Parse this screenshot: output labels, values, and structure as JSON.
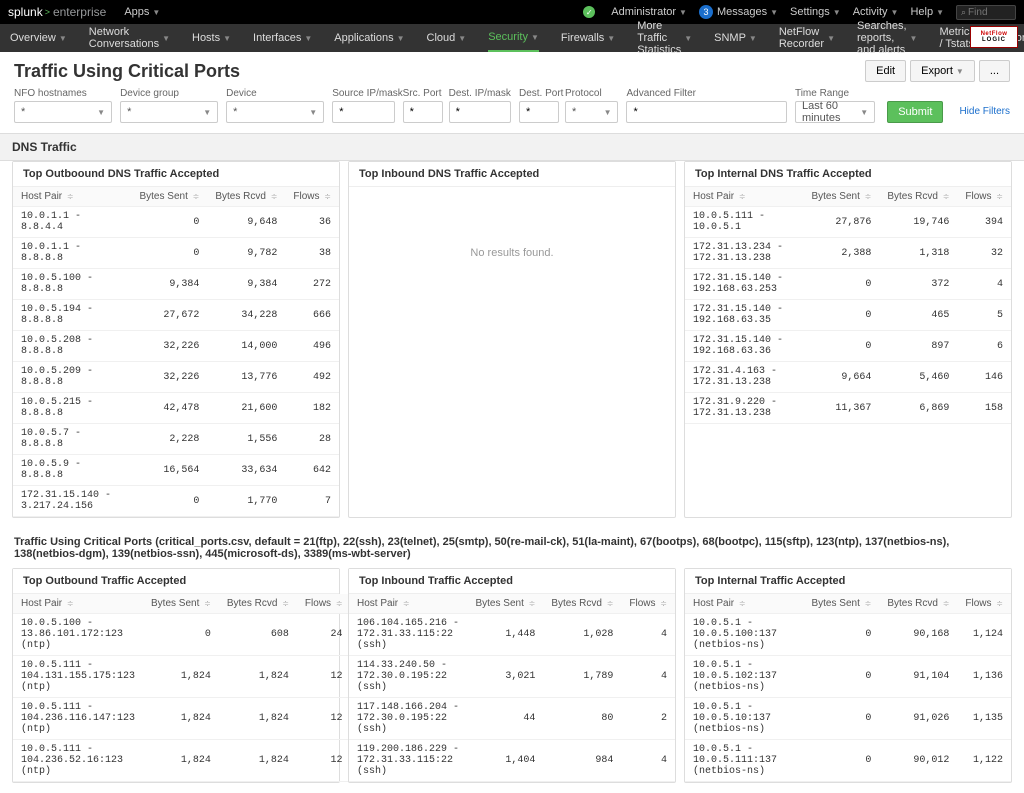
{
  "topbar": {
    "brand_main": "splunk",
    "brand_sub": "enterprise",
    "apps": "Apps",
    "admin": "Administrator",
    "messages_count": 3,
    "messages": "Messages",
    "settings": "Settings",
    "activity": "Activity",
    "help": "Help",
    "find_placeholder": "Find"
  },
  "nav": {
    "items": [
      "Overview",
      "Network Conversations",
      "Hosts",
      "Interfaces",
      "Applications",
      "Cloud",
      "Security",
      "Firewalls",
      "More Traffic Statistics",
      "SNMP",
      "NetFlow Recorder",
      "Searches, reports, and alerts",
      "Metrics / Tstats",
      "Configuration"
    ],
    "selected": 6,
    "logo1": "NetFlow",
    "logo2": "LOGIC"
  },
  "page": {
    "title": "Traffic Using Critical Ports",
    "edit": "Edit",
    "export": "Export",
    "more": "..."
  },
  "controls": {
    "labels": {
      "nfo": "NFO hostnames",
      "dgroup": "Device group",
      "device": "Device",
      "srcip": "Source IP/mask",
      "srcport": "Src. Port",
      "destip": "Dest. IP/mask",
      "destport": "Dest. Port",
      "proto": "Protocol",
      "adv": "Advanced Filter",
      "trange": "Time Range"
    },
    "values": {
      "nfo": "*",
      "dgroup": "*",
      "device": "*",
      "srcip": "*",
      "srcport": "*",
      "destip": "*",
      "destport": "*",
      "proto": "*",
      "adv": "*",
      "trange": "Last 60 minutes"
    },
    "submit": "Submit",
    "hide": "Hide Filters"
  },
  "dns_section": "DNS Traffic",
  "dns": {
    "out": {
      "title": "Top Outboound DNS Traffic Accepted",
      "cols": [
        "Host Pair",
        "Bytes Sent",
        "Bytes Rcvd",
        "Flows"
      ],
      "rows": [
        [
          "10.0.1.1 - 8.8.4.4",
          "0",
          "9,648",
          "36"
        ],
        [
          "10.0.1.1 - 8.8.8.8",
          "0",
          "9,782",
          "38"
        ],
        [
          "10.0.5.100 - 8.8.8.8",
          "9,384",
          "9,384",
          "272"
        ],
        [
          "10.0.5.194 - 8.8.8.8",
          "27,672",
          "34,228",
          "666"
        ],
        [
          "10.0.5.208 - 8.8.8.8",
          "32,226",
          "14,000",
          "496"
        ],
        [
          "10.0.5.209 - 8.8.8.8",
          "32,226",
          "13,776",
          "492"
        ],
        [
          "10.0.5.215 - 8.8.8.8",
          "42,478",
          "21,600",
          "182"
        ],
        [
          "10.0.5.7 - 8.8.8.8",
          "2,228",
          "1,556",
          "28"
        ],
        [
          "10.0.5.9 - 8.8.8.8",
          "16,564",
          "33,634",
          "642"
        ],
        [
          "172.31.15.140 - 3.217.24.156",
          "0",
          "1,770",
          "7"
        ]
      ]
    },
    "in": {
      "title": "Top Inbound DNS Traffic Accepted",
      "no_results": "No results found."
    },
    "internal": {
      "title": "Top Internal DNS Traffic Accepted",
      "cols": [
        "Host Pair",
        "Bytes Sent",
        "Bytes Rcvd",
        "Flows"
      ],
      "rows": [
        [
          "10.0.5.111 - 10.0.5.1",
          "27,876",
          "19,746",
          "394"
        ],
        [
          "172.31.13.234 - 172.31.13.238",
          "2,388",
          "1,318",
          "32"
        ],
        [
          "172.31.15.140 - 192.168.63.253",
          "0",
          "372",
          "4"
        ],
        [
          "172.31.15.140 - 192.168.63.35",
          "0",
          "465",
          "5"
        ],
        [
          "172.31.15.140 - 192.168.63.36",
          "0",
          "897",
          "6"
        ],
        [
          "172.31.4.163 - 172.31.13.238",
          "9,664",
          "5,460",
          "146"
        ],
        [
          "172.31.9.220 - 172.31.13.238",
          "11,367",
          "6,869",
          "158"
        ]
      ]
    }
  },
  "critical_desc": "Traffic Using Critical Ports (critical_ports.csv, default = 21(ftp), 22(ssh), 23(telnet), 25(smtp), 50(re-mail-ck), 51(la-maint), 67(bootps), 68(bootpc), 115(sftp), 123(ntp), 137(netbios-ns), 138(netbios-dgm), 139(netbios-ssn), 445(microsoft-ds), 3389(ms-wbt-server)",
  "crit": {
    "out": {
      "title": "Top Outbound Traffic Accepted",
      "cols": [
        "Host Pair",
        "Bytes Sent",
        "Bytes Rcvd",
        "Flows"
      ],
      "rows": [
        [
          "10.0.5.100 - 13.86.101.172:123 (ntp)",
          "0",
          "608",
          "24"
        ],
        [
          "10.0.5.111 - 104.131.155.175:123 (ntp)",
          "1,824",
          "1,824",
          "12"
        ],
        [
          "10.0.5.111 - 104.236.116.147:123 (ntp)",
          "1,824",
          "1,824",
          "12"
        ],
        [
          "10.0.5.111 - 104.236.52.16:123 (ntp)",
          "1,824",
          "1,824",
          "12"
        ]
      ]
    },
    "in": {
      "title": "Top Inbound Traffic Accepted",
      "cols": [
        "Host Pair",
        "Bytes Sent",
        "Bytes Rcvd",
        "Flows"
      ],
      "rows": [
        [
          "106.104.165.216 - 172.31.33.115:22 (ssh)",
          "1,448",
          "1,028",
          "4"
        ],
        [
          "114.33.240.50 - 172.30.0.195:22 (ssh)",
          "3,021",
          "1,789",
          "4"
        ],
        [
          "117.148.166.204 - 172.30.0.195:22 (ssh)",
          "44",
          "80",
          "2"
        ],
        [
          "119.200.186.229 - 172.31.33.115:22 (ssh)",
          "1,404",
          "984",
          "4"
        ]
      ]
    },
    "internal": {
      "title": "Top Internal Traffic Accepted",
      "cols": [
        "Host Pair",
        "Bytes Sent",
        "Bytes Rcvd",
        "Flows"
      ],
      "rows": [
        [
          "10.0.5.1 - 10.0.5.100:137 (netbios-ns)",
          "0",
          "90,168",
          "1,124"
        ],
        [
          "10.0.5.1 - 10.0.5.102:137 (netbios-ns)",
          "0",
          "91,104",
          "1,136"
        ],
        [
          "10.0.5.1 - 10.0.5.10:137 (netbios-ns)",
          "0",
          "91,026",
          "1,135"
        ],
        [
          "10.0.5.1 - 10.0.5.111:137 (netbios-ns)",
          "0",
          "90,012",
          "1,122"
        ]
      ]
    }
  }
}
